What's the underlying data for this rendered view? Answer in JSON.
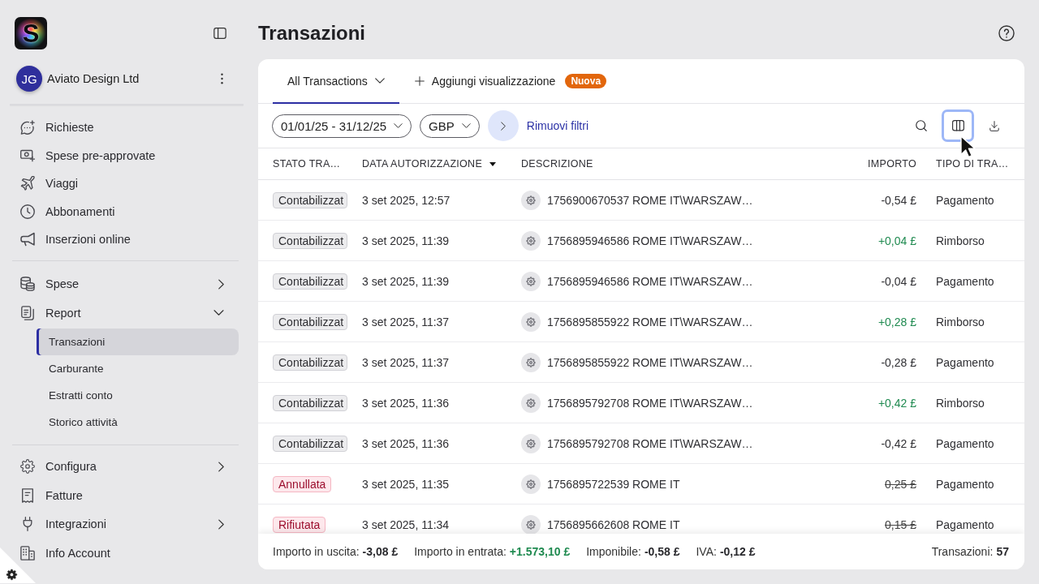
{
  "sidebar": {
    "logo": {
      "letter": "S"
    },
    "organization": {
      "initials": "JG",
      "name": "Aviato Design Ltd"
    },
    "nav_sections": [
      {
        "items": [
          {
            "kind": "link",
            "label": "Richieste",
            "selected": false
          },
          {
            "kind": "link",
            "label": "Spese pre-approvate",
            "selected": false
          },
          {
            "kind": "link",
            "label": "Viaggi",
            "selected": false
          },
          {
            "kind": "link",
            "label": "Abbonamenti",
            "selected": false
          },
          {
            "kind": "link",
            "label": "Inserzioni online",
            "selected": false
          }
        ]
      },
      {
        "items": [
          {
            "kind": "group",
            "label": "Spese",
            "selected": false,
            "expanded": false
          },
          {
            "kind": "group",
            "label": "Report",
            "selected": false,
            "expanded": true,
            "children": [
              {
                "label": "Transazioni",
                "selected": true
              },
              {
                "label": "Carburante",
                "selected": false
              },
              {
                "label": "Estratti conto",
                "selected": false
              },
              {
                "label": "Storico attività",
                "selected": false
              }
            ]
          }
        ]
      },
      {
        "items": [
          {
            "kind": "group",
            "label": "Configura",
            "selected": false,
            "expanded": false
          },
          {
            "kind": "link",
            "label": "Fatture",
            "selected": false
          },
          {
            "kind": "group",
            "label": "Integrazioni",
            "selected": false,
            "expanded": false
          },
          {
            "kind": "link",
            "label": "Info Account",
            "selected": false
          }
        ]
      }
    ]
  },
  "page": {
    "title": "Transazioni"
  },
  "views": {
    "tabs": [
      {
        "label": "All Transactions",
        "selected": true
      }
    ],
    "add_view": {
      "label": "Aggiungi visualizzazione",
      "badge": "Nuova"
    }
  },
  "filters": {
    "chips": [
      {
        "label": "01/01/25 - 31/12/25"
      },
      {
        "label": "GBP"
      }
    ],
    "clear": "Rimuovi filtri",
    "tools": [
      {
        "focused": false
      },
      {
        "focused": true
      },
      {
        "focused": false
      }
    ]
  },
  "table": {
    "columns": [
      {
        "label": "STATO TRA…",
        "sorted": false
      },
      {
        "label": "DATA AUTORIZZAZIONE",
        "sorted": true
      },
      {
        "label": "DESCRIZIONE",
        "sorted": false
      },
      {
        "label": "IMPORTO",
        "sorted": false
      },
      {
        "label": "TIPO DI TRA…",
        "sorted": false
      }
    ],
    "rows": [
      {
        "status": {
          "label": "Contabilizzat",
          "kind": "neutral"
        },
        "date": "3 set 2025, 12:57",
        "description": "1756900670537 ROME IT\\WARSZAW…",
        "amount": {
          "text": "-0,54 £",
          "kind": "debit"
        },
        "type": "Pagamento"
      },
      {
        "status": {
          "label": "Contabilizzat",
          "kind": "neutral"
        },
        "date": "3 set 2025, 11:39",
        "description": "1756895946586 ROME IT\\WARSZAW…",
        "amount": {
          "text": "+0,04 £",
          "kind": "credit"
        },
        "type": "Rimborso"
      },
      {
        "status": {
          "label": "Contabilizzat",
          "kind": "neutral"
        },
        "date": "3 set 2025, 11:39",
        "description": "1756895946586 ROME IT\\WARSZAW…",
        "amount": {
          "text": "-0,04 £",
          "kind": "debit"
        },
        "type": "Pagamento"
      },
      {
        "status": {
          "label": "Contabilizzat",
          "kind": "neutral"
        },
        "date": "3 set 2025, 11:37",
        "description": "1756895855922 ROME IT\\WARSZAW…",
        "amount": {
          "text": "+0,28 £",
          "kind": "credit"
        },
        "type": "Rimborso"
      },
      {
        "status": {
          "label": "Contabilizzat",
          "kind": "neutral"
        },
        "date": "3 set 2025, 11:37",
        "description": "1756895855922 ROME IT\\WARSZAW…",
        "amount": {
          "text": "-0,28 £",
          "kind": "debit"
        },
        "type": "Pagamento"
      },
      {
        "status": {
          "label": "Contabilizzat",
          "kind": "neutral"
        },
        "date": "3 set 2025, 11:36",
        "description": "1756895792708 ROME IT\\WARSZAW…",
        "amount": {
          "text": "+0,42 £",
          "kind": "credit"
        },
        "type": "Rimborso"
      },
      {
        "status": {
          "label": "Contabilizzat",
          "kind": "neutral"
        },
        "date": "3 set 2025, 11:36",
        "description": "1756895792708 ROME IT\\WARSZAW…",
        "amount": {
          "text": "-0,42 £",
          "kind": "debit"
        },
        "type": "Pagamento"
      },
      {
        "status": {
          "label": "Annullata",
          "kind": "danger"
        },
        "date": "3 set 2025, 11:35",
        "description": "1756895722539 ROME IT",
        "amount": {
          "text": "0,25 £",
          "kind": "void"
        },
        "type": "Pagamento"
      },
      {
        "status": {
          "label": "Rifiutata",
          "kind": "danger"
        },
        "date": "3 set 2025, 11:34",
        "description": "1756895662608 ROME IT",
        "amount": {
          "text": "0,15 £",
          "kind": "void"
        },
        "type": "Pagamento"
      }
    ]
  },
  "summary": {
    "totals": [
      {
        "label": "Importo in uscita:",
        "value": "-3,08 £",
        "kind": "neutral"
      },
      {
        "label": "Importo in entrata:",
        "value": "+1.573,10 £",
        "kind": "positive"
      },
      {
        "label": "Imponibile:",
        "value": "-0,58 £",
        "kind": "neutral"
      },
      {
        "label": "IVA:",
        "value": "-0,12 £",
        "kind": "neutral"
      }
    ],
    "count": {
      "label": "Transazioni:",
      "value": "57"
    }
  }
}
